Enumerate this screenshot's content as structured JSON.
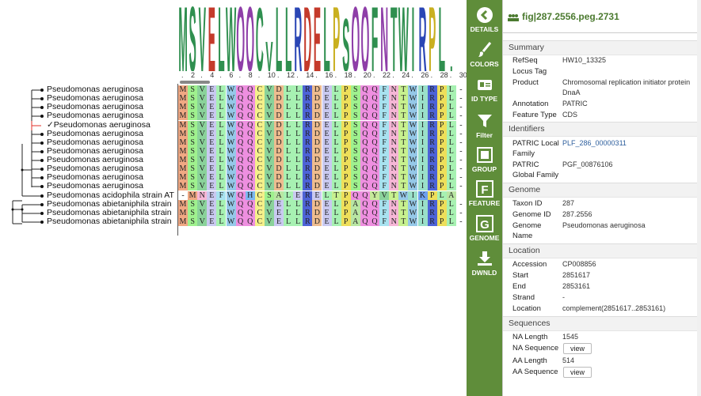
{
  "tree": {
    "labels": [
      "Pseudomonas aeruginosa",
      "Pseudomonas aeruginosa",
      "Pseudomonas aeruginosa",
      "Pseudomonas aeruginosa",
      "✓Pseudomonas aeruginosa",
      "Pseudomonas aeruginosa",
      "Pseudomonas aeruginosa",
      "Pseudomonas aeruginosa",
      "Pseudomonas aeruginosa",
      "Pseudomonas aeruginosa",
      "Pseudomonas aeruginosa",
      "Pseudomonas aeruginosa",
      "Pseudomonas acidophila strain AT",
      "Pseudomonas abietaniphila strain",
      "Pseudomonas abietaniphila strain",
      "Pseudomonas abietaniphila strain"
    ]
  },
  "logo": {
    "letters": [
      "M",
      "S",
      "V",
      "E",
      "L",
      "W",
      "Q",
      "Q",
      "C",
      "V",
      "L",
      "L",
      "R",
      "D",
      "E",
      "L",
      "P",
      "S",
      "Q",
      "Q",
      "F",
      "N",
      "T",
      "W",
      "I",
      "R",
      "P",
      "L",
      "."
    ],
    "colors": {
      "M": "#2f8f4f",
      "S": "#2f8f4f",
      "V": "#2f8f4f",
      "E": "#c43a2b",
      "L": "#2f8f4f",
      "W": "#2f8f4f",
      "Q": "#8e3ea8",
      "C": "#2f8f4f",
      "R": "#2a46b5",
      "D": "#c43a2b",
      "P": "#c9b020",
      "F": "#2f8f4f",
      "N": "#8e3ea8",
      "T": "#2f8f4f",
      "I": "#2f8f4f",
      ".": "#2f8f4f"
    }
  },
  "ruler": [
    "2",
    "4",
    "6",
    "8",
    "10",
    "12",
    "14",
    "16",
    "18",
    "20",
    "22",
    "24",
    "26",
    "28",
    "30"
  ],
  "alignment": {
    "rows": [
      "MSVELWQQCVDLLRDELPSQQFNTWIRPL-",
      "MSVELWQQCVDLLRDELPSQQFNTWIRPL-",
      "MSVELWQQCVDLLRDELPSQQFNTWIRPL-",
      "MSVELWQQCVDLLRDELPSQQFNTWIRPL-",
      "MSVELWQQCVDLLRDELPSQQFNTWIRPL-",
      "MSVELWQQCVDLLRDELPSQQFNTWIRPL-",
      "MSVELWQQCVDLLRDELPSQQFNTWIRPL-",
      "MSVELWQQCVDLLRDELPSQQFNTWIRPL-",
      "MSVELWQQCVDLLRDELPSQQFNTWIRPL-",
      "MSVELWQQCVDLLRDELPSQQFNTWIRPL-",
      "MSVELWQQCVDLLRDELPSQQFNTWIRPL-",
      "MSVELWQQCVDLLRDELPSQQFNTWIRPL-",
      "-MNEFWQHCSALERELTPQQYVTWIKPLA",
      "MSVELWQQCVELLRDELPAQQFNTWIRPL-",
      "MSVELWQQCVELLRDELPAQQFNTWIRPL-",
      "MSVELWQQCVELLRDELPAQQFNTWIRPL-"
    ],
    "residue_colors": {
      "M": "#f0a883",
      "S": "#9ff18e",
      "V": "#8ad29a",
      "E": "#c9c9f0",
      "L": "#a7f1b2",
      "W": "#95c8e8",
      "Q": "#ee8fe0",
      "C": "#f4f08a",
      "D": "#eebc8f",
      "R": "#4d63d6",
      "P": "#eedf5a",
      "F": "#a8e2f0",
      "N": "#f6b6d6",
      "T": "#c7f18f",
      "I": "#9ae0c9",
      "H": "#7cb8f0",
      "A": "#b9e6a3",
      "K": "#6ea0ee",
      "Y": "#c6e99a",
      "G": "#e2e2e2",
      "-": "#ffffff"
    }
  },
  "toolbar": [
    {
      "icon": "chevron-left-icon",
      "label": "DETAILS"
    },
    {
      "icon": "paintbrush-icon",
      "label": "COLORS"
    },
    {
      "icon": "id-card-icon",
      "label": "ID TYPE"
    },
    {
      "icon": "filter-icon",
      "label": "Filter"
    },
    {
      "icon": "group-icon",
      "label": "GROUP"
    },
    {
      "icon": "feature-icon",
      "label": "FEATURE"
    },
    {
      "icon": "genome-icon",
      "label": "GENOME"
    },
    {
      "icon": "download-icon",
      "label": "DWNLD"
    }
  ],
  "panel": {
    "title": "fig|287.2556.peg.2731",
    "summary": {
      "heading": "Summary",
      "refseq_k": "RefSeq",
      "refseq_v": "HW10_13325",
      "locus_k": "Locus Tag",
      "locus_v": "",
      "product_k": "Product",
      "product_v": "Chromosomal replication initiator protein DnaA",
      "annotation_k": "Annotation",
      "annotation_v": "PATRIC",
      "ftype_k": "Feature Type",
      "ftype_v": "CDS"
    },
    "identifiers": {
      "heading": "Identifiers",
      "plf_k": "PATRIC Local Family",
      "plf_v": "PLF_286_00000311",
      "pgf_k": "PATRIC Global Family",
      "pgf_v": "PGF_00876106"
    },
    "genome": {
      "heading": "Genome",
      "taxon_k": "Taxon ID",
      "taxon_v": "287",
      "gid_k": "Genome ID",
      "gid_v": "287.2556",
      "gname_k": "Genome Name",
      "gname_v": "Pseudomonas aeruginosa"
    },
    "location": {
      "heading": "Location",
      "acc_k": "Accession",
      "acc_v": "CP008856",
      "start_k": "Start",
      "start_v": "2851617",
      "end_k": "End",
      "end_v": "2853161",
      "strand_k": "Strand",
      "strand_v": "-",
      "loc_k": "Location",
      "loc_v": "complement(2851617..2853161)"
    },
    "sequences": {
      "heading": "Sequences",
      "nal_k": "NA Length",
      "nal_v": "1545",
      "nas_k": "NA Sequence",
      "view_label": "view",
      "aal_k": "AA Length",
      "aal_v": "514",
      "aas_k": "AA Sequence"
    }
  }
}
